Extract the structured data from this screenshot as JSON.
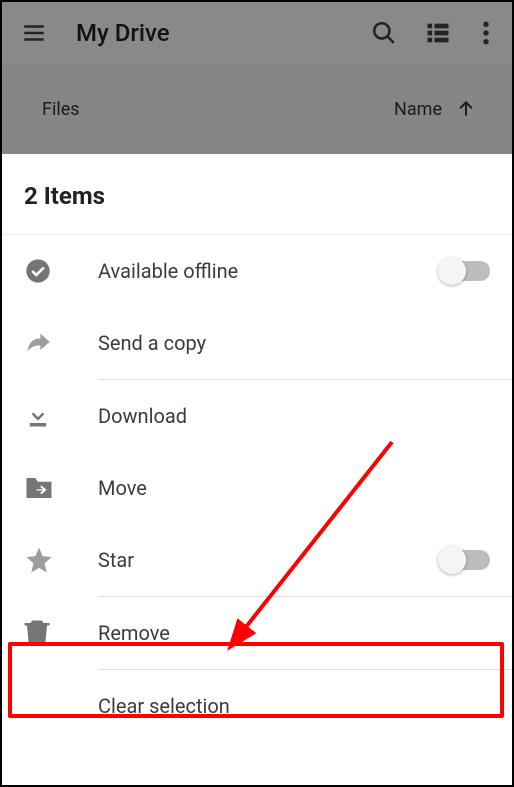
{
  "appbar": {
    "title": "My Drive"
  },
  "subbar": {
    "left": "Files",
    "sort": "Name"
  },
  "selection_count": "2 Items",
  "actions": {
    "offline": "Available offline",
    "send_copy": "Send a copy",
    "download": "Download",
    "move": "Move",
    "star": "Star",
    "remove": "Remove",
    "clear_selection": "Clear selection"
  }
}
